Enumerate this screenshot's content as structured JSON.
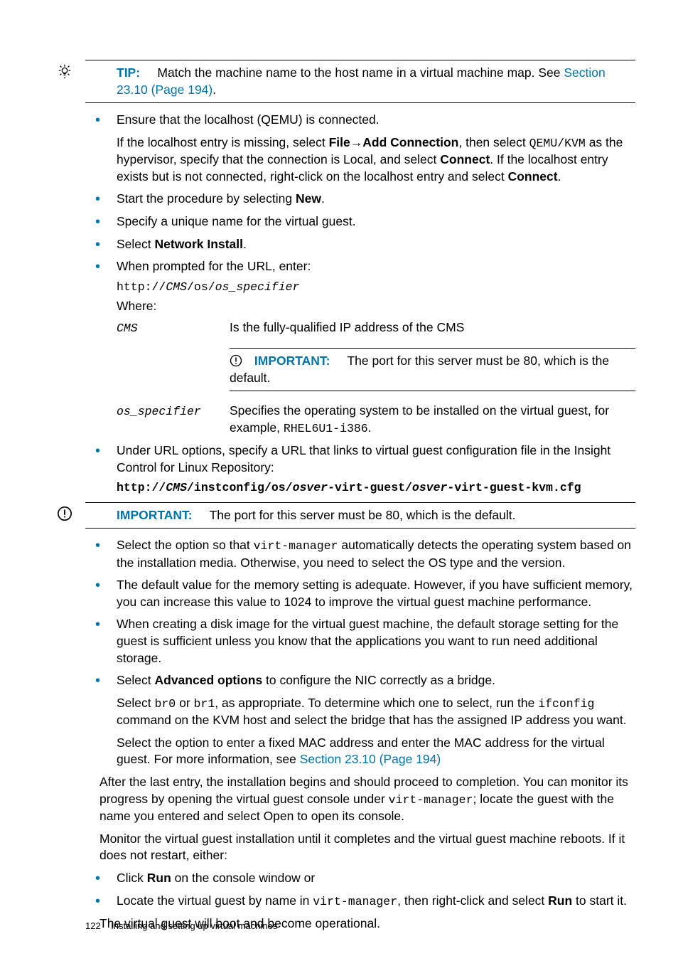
{
  "tip": {
    "label": "TIP:",
    "text_a": "Match the machine name to the host name in a virtual machine map. See ",
    "link": "Section 23.10 (Page 194)",
    "text_b": "."
  },
  "steps": {
    "localhost_a": "Ensure that the localhost (QEMU) is connected.",
    "localhost_b1": "If the localhost entry is missing, select ",
    "localhost_b_file": "File",
    "localhost_b_arrow": "→",
    "localhost_b_add": "Add Connection",
    "localhost_b2": ", then select ",
    "localhost_b_qemu": "QEMU/KVM",
    "localhost_b3": " as the hypervisor, specify that the connection is Local, and select ",
    "localhost_b_connect": "Connect",
    "localhost_b4": ". If the localhost entry exists but is not connected, right-click on the localhost entry and select ",
    "localhost_b_connect2": "Connect",
    "localhost_b5": ".",
    "new_a": "Start the procedure by selecting ",
    "new_b": "New",
    "new_c": ".",
    "unique": "Specify a unique name for the virtual guest.",
    "netinstall_a": "Select ",
    "netinstall_b": "Network Install",
    "netinstall_c": ".",
    "url_prompt": "When prompted for the URL, enter:",
    "url_code_a": "http://",
    "url_code_cms": "CMS",
    "url_code_b": "/os/",
    "url_code_spec": "os_specifier",
    "where": "Where:",
    "term_cms": "CMS",
    "def_cms": "Is the fully-qualified IP address of the CMS",
    "imp1_label": "IMPORTANT:",
    "imp1_text": "The port for this server must be 80, which is the default.",
    "term_spec": "os_specifier",
    "def_spec_a": "Specifies the operating system to be installed on the virtual guest, for example, ",
    "def_spec_b": "RHEL6U1-i386",
    "def_spec_c": ".",
    "urlopts_a": "Under URL options, specify a URL that links to virtual guest configuration file in the Insight Control for Linux Repository:",
    "urlopts_code_a": "http://",
    "urlopts_code_cms": "CMS",
    "urlopts_code_b": "/instconfig/os/",
    "urlopts_code_osver1": "osver",
    "urlopts_code_c": "-virt-guest/",
    "urlopts_code_osver2": "osver",
    "urlopts_code_d": "-virt-guest-kvm.cfg"
  },
  "imp2": {
    "label": "IMPORTANT:",
    "text": "The port for this server must be 80, which is the default."
  },
  "steps2": {
    "autodetect_a": "Select the option so that ",
    "autodetect_vm": "virt-manager",
    "autodetect_b": " automatically detects the operating system based on the installation media. Otherwise, you need to select the OS type and the version.",
    "mem": "The default value for the memory setting is adequate. However, if you have sufficient memory, you can increase this value to 1024 to improve the virtual guest machine performance.",
    "disk": "When creating a disk image for the virtual guest machine, the default storage setting for the guest is sufficient unless you know that the applications you want to run need additional storage.",
    "adv_a": "Select ",
    "adv_b": "Advanced options",
    "adv_c": " to configure the NIC correctly as a bridge.",
    "bridge_a": "Select ",
    "bridge_br0": "br0",
    "bridge_b": " or ",
    "bridge_br1": "br1",
    "bridge_c": ", as appropriate. To determine which one to select, run the ",
    "bridge_ifc": "ifconfig",
    "bridge_d": " command on the KVM host and select the bridge that has the assigned IP address you want.",
    "mac_a": "Select the option to enter a fixed MAC address and enter the MAC address for the virtual guest. For more information, see ",
    "mac_link": "Section 23.10 (Page 194)"
  },
  "after": {
    "p1_a": "After the last entry, the installation begins and should proceed to completion. You can monitor its progress by opening the virtual guest console under ",
    "p1_vm": "virt-manager",
    "p1_b": "; locate the guest with the name you entered and select Open to open its console.",
    "p2": "Monitor the virtual guest installation until it completes and the virtual guest machine reboots. If it does not restart, either:",
    "li1_a": "Click ",
    "li1_b": "Run",
    "li1_c": " on the console window or",
    "li2_a": "Locate the virtual guest by name in ",
    "li2_vm": "virt-manager",
    "li2_b": ", then right-click and select ",
    "li2_run": "Run",
    "li2_c": " to start it.",
    "p3": "The virtual guest will boot and become operational."
  },
  "footer": {
    "page": "122",
    "title": "Installing and setting up virtual machines"
  }
}
